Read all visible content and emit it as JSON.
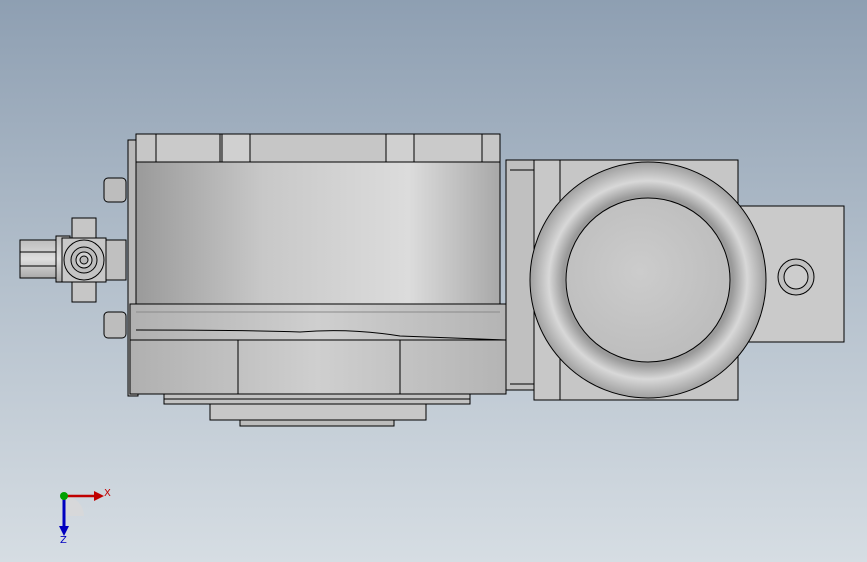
{
  "viewport": {
    "background_top": "#8e9fb2",
    "background_bottom": "#d6dde3"
  },
  "model": {
    "view": "top",
    "color_body": "#c4c4c4",
    "color_edge": "#000000"
  },
  "triad": {
    "x_label": "X",
    "z_label": "Z",
    "x_color": "#c00000",
    "y_color": "#00a000",
    "z_color": "#0000c0"
  }
}
